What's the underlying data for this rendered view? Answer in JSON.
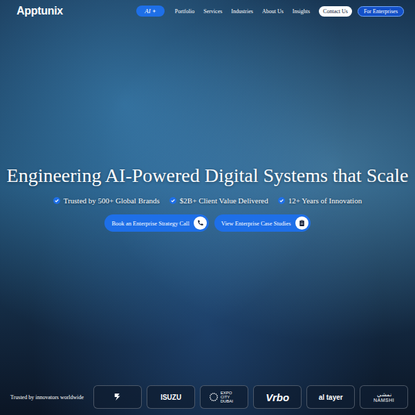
{
  "nav": {
    "logo": "Apptunix",
    "ai_pill": "AI",
    "links": [
      "Portfolio",
      "Services",
      "Industries",
      "About Us",
      "Insights"
    ],
    "contact": "Contact Us",
    "enterprise": "For Enterprises"
  },
  "hero": {
    "title": "Engineering AI-Powered Digital Systems that Scale",
    "highlights": [
      "Trusted by 500+ Global Brands",
      "$2B+ Client Value Delivered",
      "12+ Years of Innovation"
    ],
    "buttons": [
      {
        "label": "Book an Enterprise Strategy Call",
        "kind": "call"
      },
      {
        "label": "View Enterprise Case Studies",
        "kind": "cases"
      }
    ]
  },
  "trusted": {
    "label": "Trusted by innovators worldwide",
    "logos": [
      {
        "kind": "mark",
        "label": "",
        "sub": ""
      },
      {
        "kind": "text",
        "label": "ISUZU",
        "sub": ""
      },
      {
        "kind": "expo",
        "label": "EXPO CITY DUBAI",
        "sub": ""
      },
      {
        "kind": "script",
        "label": "Vrbo",
        "sub": ""
      },
      {
        "kind": "text",
        "label": "al tayer",
        "sub": ""
      },
      {
        "kind": "stack",
        "label": "NAMSHI",
        "sub": "نمشي"
      }
    ]
  }
}
